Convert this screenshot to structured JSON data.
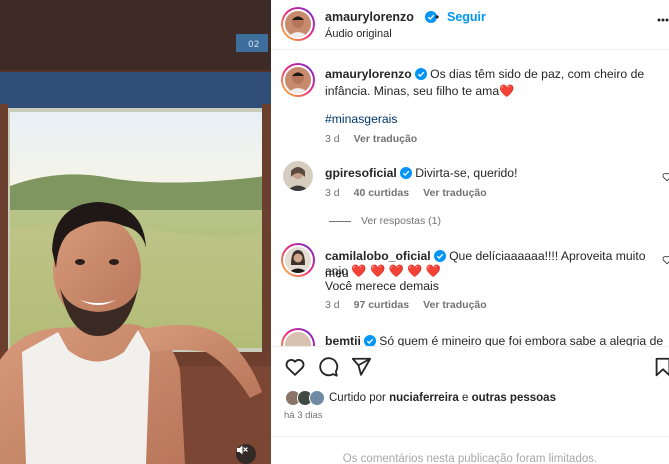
{
  "post": {
    "author": "amaurylorenzo",
    "dot": "•",
    "follow_label": "Seguir",
    "audio": "Áudio original"
  },
  "photo": {
    "train_number": "02",
    "icons": {
      "mute": "muted-speaker-icon"
    }
  },
  "caption": {
    "author": "amaurylorenzo",
    "text": "Os dias têm sido de paz, com cheiro de infância. Minas, seu filho te ama❤️",
    "hashtag": "#minasgerais",
    "time": "3 d",
    "translate": "Ver tradução"
  },
  "comments": [
    {
      "author": "gpiresoficial",
      "text": "Divirta-se, querido!",
      "time": "3 d",
      "likes": "40 curtidas",
      "translate": "Ver tradução",
      "view_replies": "Ver respostas (1)"
    },
    {
      "author": "camilalobo_oficial",
      "text_line1": "Que delíciaaaaaa!!!! Aproveita muito meu",
      "text_line2": "anjo ❤️ ❤️ ❤️ ❤️ ❤️",
      "text_line3": "Você merece demais",
      "time": "3 d",
      "likes": "97 curtidas",
      "translate": "Ver tradução"
    },
    {
      "author": "bemtii",
      "text": "Só quem é mineiro que foi embora sabe a alegria de"
    }
  ],
  "actions": {
    "icons": [
      "heart-icon",
      "comment-icon",
      "share-icon",
      "save-icon"
    ]
  },
  "likes_summary": {
    "prefix": "Curtido por",
    "user": "nuciaferreira",
    "joiner": "e",
    "others": "outras pessoas"
  },
  "posted": "há 3 dias",
  "comments_limited": "Os comentários nesta publicação foram limitados.",
  "colors": {
    "accent": "#0095f6",
    "verified": "#0095f6",
    "text": "#262626",
    "muted": "#737373"
  }
}
